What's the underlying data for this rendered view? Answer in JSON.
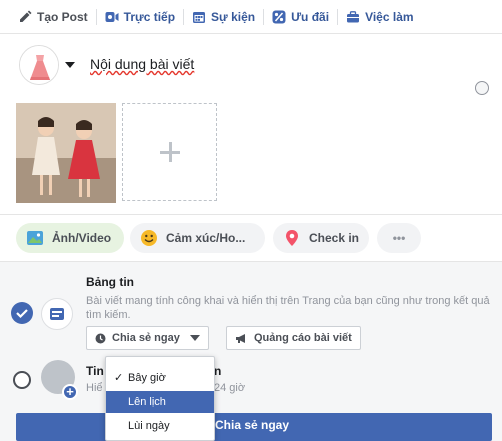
{
  "tabs": [
    {
      "label": "Tạo Post",
      "icon": "pencil-icon"
    },
    {
      "label": "Trực tiếp",
      "icon": "live-video-icon"
    },
    {
      "label": "Sự kiện",
      "icon": "calendar-icon"
    },
    {
      "label": "Ưu đãi",
      "icon": "offer-percent-icon"
    },
    {
      "label": "Việc làm",
      "icon": "briefcase-icon"
    }
  ],
  "composer": {
    "placeholder_text": "Nội dung bài viết"
  },
  "actions": [
    {
      "label": "Ảnh/Video",
      "icon": "photo-icon"
    },
    {
      "label": "Cảm xúc/Ho...",
      "icon": "emoji-icon"
    },
    {
      "label": "Check in",
      "icon": "location-pin-icon"
    },
    {
      "label": "•••",
      "icon": "more-icon"
    }
  ],
  "publish": {
    "feed": {
      "title": "Bảng tin",
      "description": "Bài viết mang tính công khai và hiển thị trên Trang của bạn cũng như trong kết quả tìm kiếm."
    },
    "share_timing_label": "Chia sẻ ngay",
    "boost_label": "Quảng cáo bài viết",
    "story": {
      "title_part1": "Tin",
      "title_part2": "n",
      "subtitle_part1": "Hiể",
      "subtitle_part2": "24 giờ"
    },
    "share_button_label": "Chia sẻ ngay"
  },
  "dropdown": {
    "options": [
      "Bây giờ",
      "Lên lịch",
      "Lùi ngày"
    ],
    "selected_check": "✓",
    "highlighted_index": 1
  },
  "colors": {
    "facebook_blue": "#4267b2",
    "active_pill_bg": "#e7f3e1"
  }
}
